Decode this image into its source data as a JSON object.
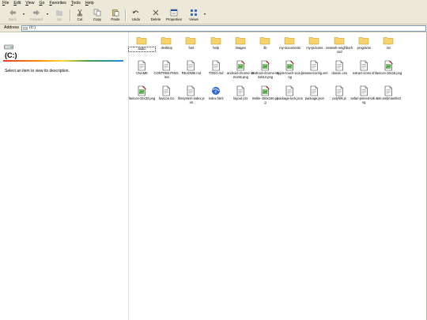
{
  "menu": {
    "items": [
      {
        "acc": "F",
        "rest": "ile"
      },
      {
        "acc": "E",
        "rest": "dit"
      },
      {
        "acc": "V",
        "rest": "iew"
      },
      {
        "acc": "G",
        "rest": "o"
      },
      {
        "acc": "F",
        "rest": "avorites"
      },
      {
        "acc": "T",
        "rest": "ools"
      },
      {
        "acc": "H",
        "rest": "elp"
      }
    ]
  },
  "toolbar": {
    "back_label": "Back",
    "forward_label": "Forward",
    "up_label": "Up",
    "cut_label": "Cut",
    "copy_label": "Copy",
    "paste_label": "Paste",
    "undo_label": "Undo",
    "delete_label": "Delete",
    "properties_label": "Properties",
    "views_label": "Views"
  },
  "address": {
    "label": "Address",
    "value": "(C:)"
  },
  "left_panel": {
    "title": "(C:)",
    "description": "Select an item to view its description."
  },
  "items": [
    {
      "name": "audio",
      "type": "folder",
      "selected": true
    },
    {
      "name": "desktop",
      "type": "folder"
    },
    {
      "name": "font",
      "type": "folder"
    },
    {
      "name": "help",
      "type": "folder"
    },
    {
      "name": "images",
      "type": "folder"
    },
    {
      "name": "lib",
      "type": "folder"
    },
    {
      "name": "my-documents",
      "type": "folder"
    },
    {
      "name": "my-pictures",
      "type": "folder"
    },
    {
      "name": "network-neighborhood",
      "type": "folder"
    },
    {
      "name": "programs",
      "type": "folder"
    },
    {
      "name": "src",
      "type": "folder"
    },
    {
      "name": "CNAME",
      "type": "file"
    },
    {
      "name": "CONTRIBUTING.md",
      "type": "file"
    },
    {
      "name": "README.md",
      "type": "file"
    },
    {
      "name": "TODO.md",
      "type": "file"
    },
    {
      "name": "android-chrome-192x192.png",
      "type": "image"
    },
    {
      "name": "android-chrome-512x512.png",
      "type": "image"
    },
    {
      "name": "apple-touch-icon.png",
      "type": "image"
    },
    {
      "name": "browserconfig.xml",
      "type": "file"
    },
    {
      "name": "classic.css",
      "type": "file"
    },
    {
      "name": "extract-icons.sh",
      "type": "file"
    },
    {
      "name": "favicon-16x16.png",
      "type": "image"
    },
    {
      "name": "favicon-32x32.png",
      "type": "image"
    },
    {
      "name": "favicon.ico",
      "type": "file"
    },
    {
      "name": "filesystem-index.json",
      "type": "file"
    },
    {
      "name": "index.html",
      "type": "html"
    },
    {
      "name": "layout.css",
      "type": "file"
    },
    {
      "name": "mstile-150x150.png",
      "type": "image"
    },
    {
      "name": "package-lock.json",
      "type": "file"
    },
    {
      "name": "package.json",
      "type": "file"
    },
    {
      "name": "polyfills.js",
      "type": "file"
    },
    {
      "name": "safari-pinned-tab.svg",
      "type": "file"
    },
    {
      "name": "site.webmanifest",
      "type": "file"
    }
  ],
  "colors": {
    "chrome": "#ece9d8",
    "folder": "#f7d46b",
    "address_border": "#7f9db9"
  }
}
